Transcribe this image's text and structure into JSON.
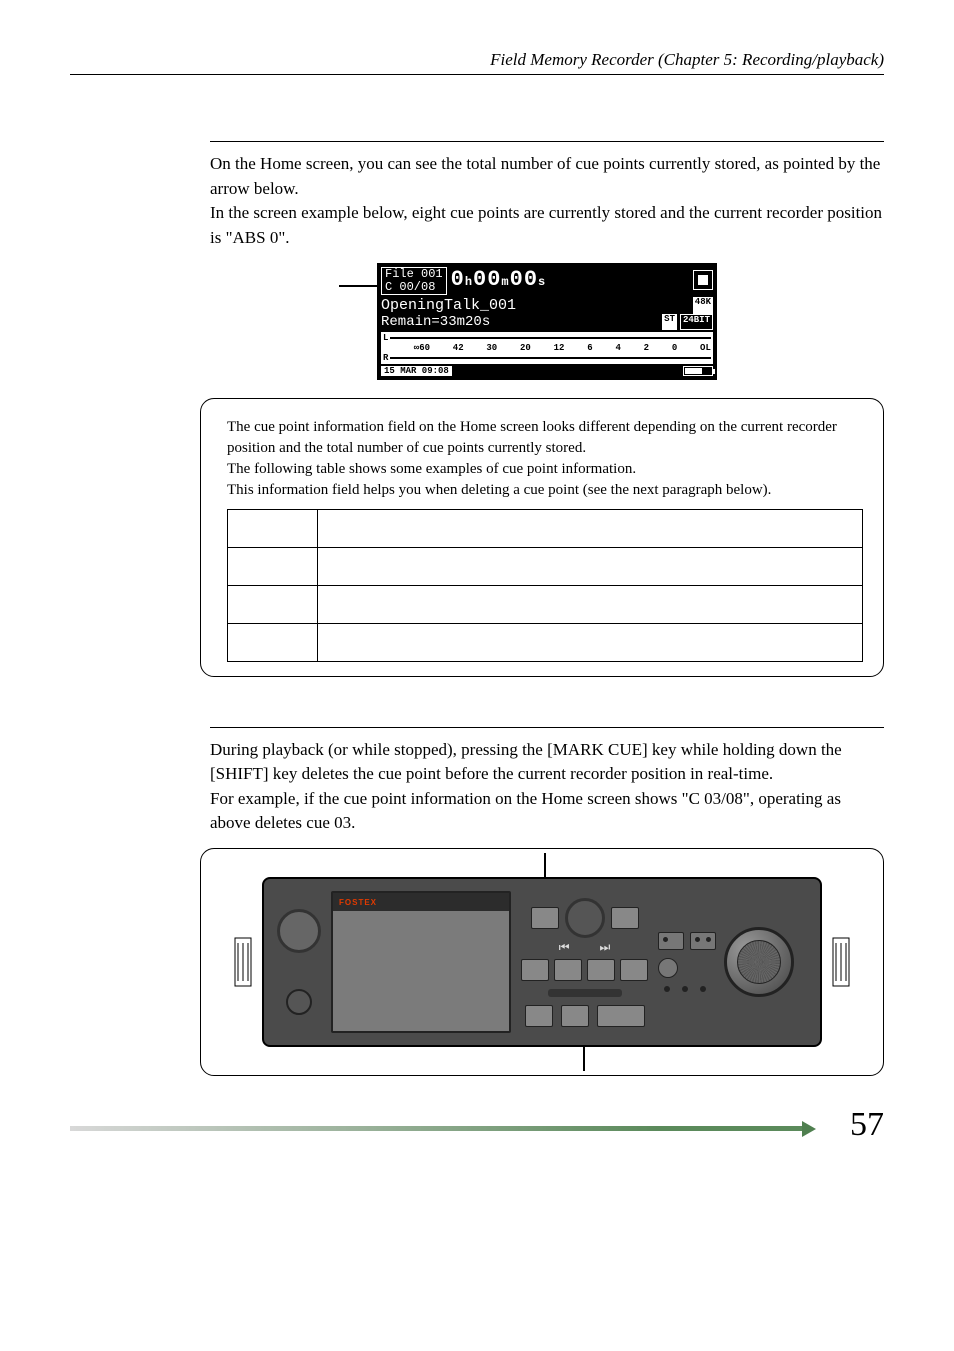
{
  "header": {
    "running_title": "Field Memory Recorder (Chapter 5: Recording/playback)"
  },
  "section_view": {
    "p1": "On the Home screen, you can see the total number of cue points currently stored, as pointed by the arrow below.",
    "p2": "In the screen example below, eight cue points are currently stored and the current recorder position is \"ABS 0\"."
  },
  "lcd": {
    "file_line": "File 001",
    "cue_line": "C 00/08",
    "time_h": "0",
    "time_m": "00",
    "time_s": "00",
    "unit_h": "h",
    "unit_m": "m",
    "unit_s": "s",
    "name_line": "OpeningTalk_001",
    "khz_badge": "48K",
    "remain_line": "Remain=33m20s",
    "st_badge": "ST",
    "bit_badge": "24BIT",
    "scale_L": "L",
    "scale_R": "R",
    "scale_labels": [
      "∞60",
      "42",
      "30",
      "20",
      "12",
      "6",
      "4",
      "2",
      "0",
      "OL"
    ],
    "date": "15 MAR 09:08"
  },
  "info_box": {
    "p1": "The cue point information field on the Home screen looks different depending on the current recorder position and the total number of cue points currently stored.",
    "p2": "The following table shows some examples of cue point information.",
    "p3": "This information field helps you when deleting a cue point (see the next paragraph below).",
    "rows": [
      {
        "c1": "",
        "c2": ""
      },
      {
        "c1": "",
        "c2": ""
      },
      {
        "c1": "",
        "c2": ""
      },
      {
        "c1": "",
        "c2": ""
      }
    ]
  },
  "section_delete": {
    "p1": "During playback (or while stopped), pressing the [MARK CUE] key while holding down the [SHIFT] key deletes the cue point before the current recorder position in real-time.",
    "p2": "For example, if the cue point information on the Home screen shows \"C 03/08\", operating as above deletes cue 03."
  },
  "device": {
    "brand": "FOSTEX"
  },
  "page_number": "57"
}
